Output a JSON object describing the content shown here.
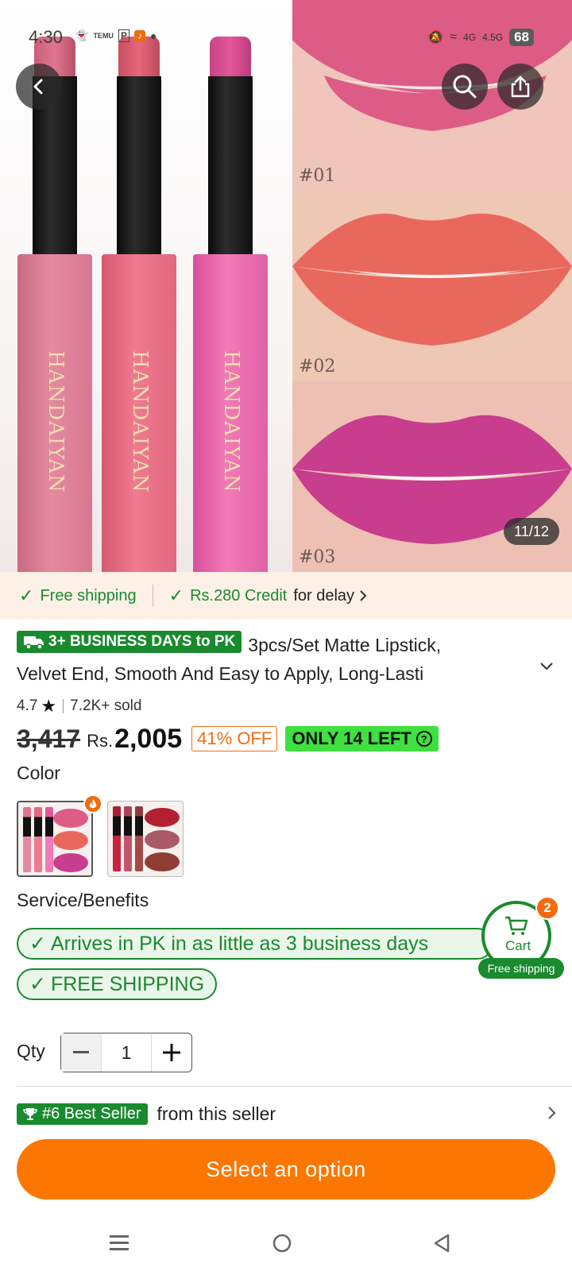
{
  "status_bar": {
    "time": "4:30",
    "left_icons": [
      "snapchat-icon",
      "temu-icon",
      "p-icon",
      "tiktok-icon",
      "dot-icon"
    ],
    "network_1": "4G",
    "network_2": "4.5G",
    "battery": "68"
  },
  "gallery": {
    "counter": "11/12",
    "brand_text": "HANDAIYAN",
    "shades": [
      "#01",
      "#02",
      "#03"
    ],
    "stick_colors": [
      "#e07590",
      "#e8667c",
      "#e3579a"
    ],
    "lip_colors": [
      "#dd5c86",
      "#e9685e",
      "#c83d8e"
    ]
  },
  "info_strip": {
    "free_shipping": "Free shipping",
    "credit": "Rs.280 Credit",
    "credit_suffix": "for delay"
  },
  "product": {
    "shipping_badge": "3+ BUSINESS DAYS to PK",
    "title_line1": "3pcs/Set Matte Lipstick,",
    "title_line2": "Velvet End, Smooth And Easy to Apply, Long-Lasti",
    "rating": "4.7",
    "sold": "7.2K+ sold",
    "old_price": "3,417",
    "currency": "Rs.",
    "price": "2,005",
    "discount": "41% OFF",
    "stock": "ONLY 14 LEFT"
  },
  "color": {
    "label": "Color",
    "options": [
      "pink-set",
      "red-set"
    ]
  },
  "service": {
    "label": "Service/Benefits",
    "benefit_1": "Arrives in PK in as little as 3 business days",
    "benefit_2": "FREE SHIPPING"
  },
  "cart": {
    "count": "2",
    "label": "Cart",
    "shipping": "Free shipping"
  },
  "qty": {
    "label": "Qty",
    "value": "1"
  },
  "best_seller": {
    "badge": "#6 Best Seller",
    "text": "from this seller"
  },
  "cta": {
    "label": "Select an option"
  },
  "colors": {
    "accent_orange": "#fb7701",
    "green": "#1a8a2e",
    "bright_green": "#3fe03f"
  }
}
